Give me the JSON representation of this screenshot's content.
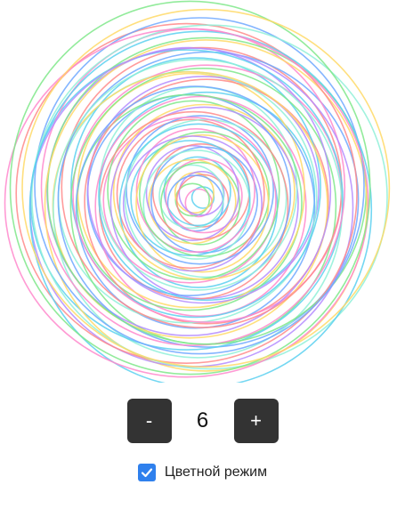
{
  "controls": {
    "decrement_label": "-",
    "count": "6",
    "increment_label": "+"
  },
  "mode": {
    "label": "Цветной режим",
    "checked": true
  },
  "colors": {
    "button_bg": "#333333",
    "button_text": "#ffffff",
    "checkbox_accent": "#2f80ed",
    "stroke_palette": [
      "#5ad0f0",
      "#ff88cc",
      "#7fe88a",
      "#ffd966",
      "#b48cff",
      "#ff8a8a",
      "#6fa8ff",
      "#8ff0d8"
    ]
  }
}
